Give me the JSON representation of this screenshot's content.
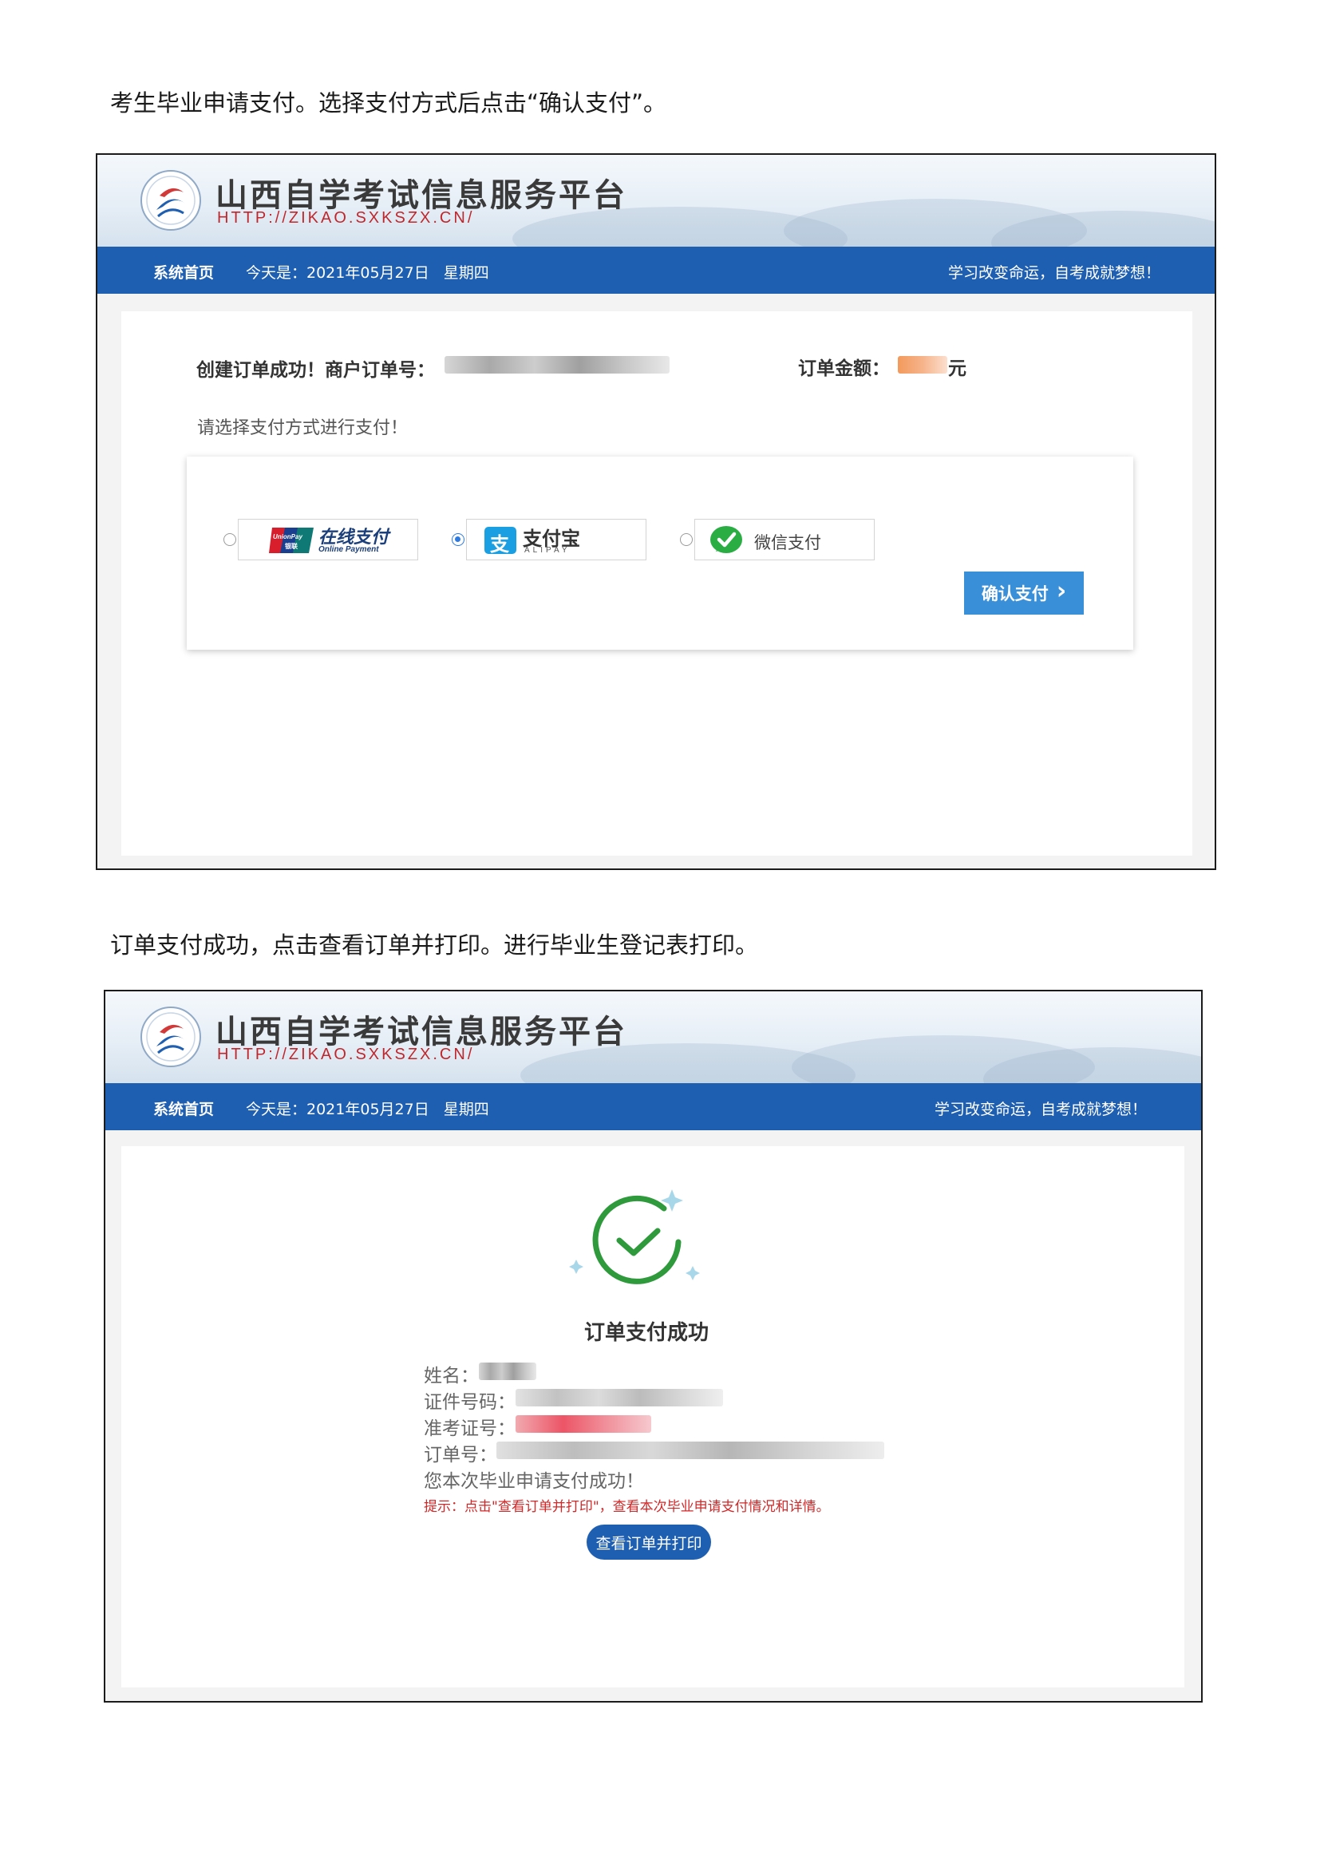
{
  "instructions": {
    "step1": "考生毕业申请支付。选择支付方式后点击“确认支付”。",
    "step2": "订单支付成功，点击查看订单并打印。进行毕业生登记表打印。"
  },
  "site": {
    "title": "山西自学考试信息服务平台",
    "url": "HTTP://ZIKAO.SXKSZX.CN/",
    "nav_home": "系统首页",
    "date_text": "今天是：2021年05月27日",
    "weekday": "星期四",
    "motto": "学习改变命运，自考成就梦想！"
  },
  "payment_page": {
    "order_created_label": "创建订单成功！商户订单号：",
    "order_amount_label": "订单金额：",
    "currency_unit": "元",
    "select_prompt": "请选择支付方式进行支付！",
    "methods": [
      {
        "name": "unionpay",
        "label": "在线支付",
        "sublabel": "Online Payment",
        "badge_top": "UnionPay",
        "badge_bottom": "银联",
        "selected": false
      },
      {
        "name": "alipay",
        "label": "支付宝",
        "sublabel": "ALIPAY",
        "icon_char": "支",
        "selected": true
      },
      {
        "name": "wechat",
        "label": "微信支付",
        "selected": false
      }
    ],
    "confirm_button": "确认支付",
    "confirm_chevron": "›"
  },
  "success_page": {
    "title": "订单支付成功",
    "fields": {
      "name_label": "姓名：",
      "id_label": "证件号码：",
      "exam_no_label": "准考证号：",
      "order_no_label": "订单号："
    },
    "message": "您本次毕业申请支付成功！",
    "tip": "提示：点击\"查看订单并打印\"，查看本次毕业申请支付情况和详情。",
    "print_button": "查看订单并打印"
  },
  "colors": {
    "nav_blue": "#1f5fb1",
    "confirm_blue": "#3a8fd9",
    "url_red": "#c0272d",
    "success_green": "#2e9a3c",
    "tip_red": "#d02828"
  },
  "icons": [
    "site-logo-icon",
    "unionpay-icon",
    "alipay-icon",
    "wechat-pay-icon",
    "chevron-right-icon",
    "success-check-icon"
  ]
}
